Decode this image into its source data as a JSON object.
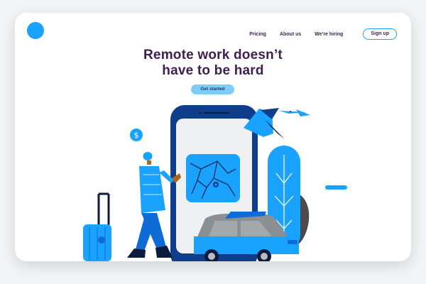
{
  "nav": {
    "links": [
      {
        "label": "Pricing"
      },
      {
        "label": "About us"
      },
      {
        "label": "We're hiring"
      }
    ],
    "signup_label": "Sign up"
  },
  "hero": {
    "title_line1": "Remote work doesn’t",
    "title_line2": "have to be hard",
    "cta_label": "Get started"
  },
  "colors": {
    "brand_blue": "#1aa2ff",
    "dark_purple": "#3e1f4f",
    "cta_blue": "#7ccdf9",
    "navy": "#0f3f8c"
  },
  "icons": [
    "logo-circle",
    "dollar-icon"
  ]
}
